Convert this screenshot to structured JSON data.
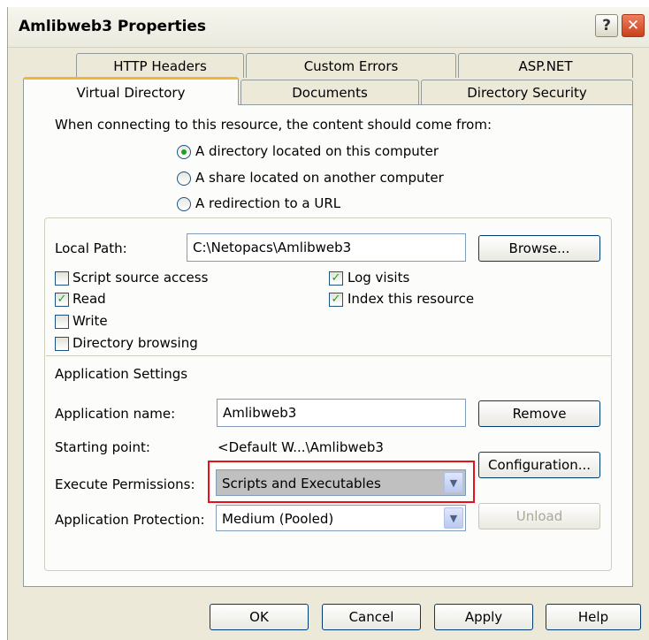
{
  "window": {
    "title": "Amlibweb3 Properties"
  },
  "titlebar": {
    "help_glyph": "?",
    "close_glyph": "✕"
  },
  "tabs": {
    "back": [
      "HTTP Headers",
      "Custom Errors",
      "ASP.NET"
    ],
    "front": [
      "Virtual Directory",
      "Documents",
      "Directory Security"
    ],
    "active": "Virtual Directory"
  },
  "content": {
    "prompt": "When connecting to this resource, the content should come from:",
    "sources": [
      {
        "label": "A directory located on this computer",
        "checked": true
      },
      {
        "label": "A share located on another computer",
        "checked": false
      },
      {
        "label": "A redirection to a URL",
        "checked": false
      }
    ],
    "local_path": {
      "label": "Local Path:",
      "value": "C:\\Netopacs\\Amlibweb3",
      "browse": "Browse..."
    },
    "checkboxes": {
      "script_source_access": {
        "label": "Script source access",
        "checked": false
      },
      "read": {
        "label": "Read",
        "checked": true
      },
      "write": {
        "label": "Write",
        "checked": false
      },
      "directory_browsing": {
        "label": "Directory browsing",
        "checked": false
      },
      "log_visits": {
        "label": "Log visits",
        "checked": true
      },
      "index_resource": {
        "label": "Index this resource",
        "checked": true
      }
    },
    "app_settings": {
      "heading": "Application Settings",
      "name_label": "Application name:",
      "name_value": "Amlibweb3",
      "remove": "Remove",
      "start_label": "Starting point:",
      "start_value": "<Default W...\\Amlibweb3",
      "configuration": "Configuration...",
      "exec_label": "Execute Permissions:",
      "exec_value": "Scripts and Executables",
      "protection_label": "Application Protection:",
      "protection_value": "Medium (Pooled)",
      "unload": "Unload"
    }
  },
  "footer": {
    "ok": "OK",
    "cancel": "Cancel",
    "apply": "Apply",
    "help": "Help"
  },
  "colors": {
    "highlight_border": "#e8101a",
    "tab_accent": "#f4b33a"
  }
}
